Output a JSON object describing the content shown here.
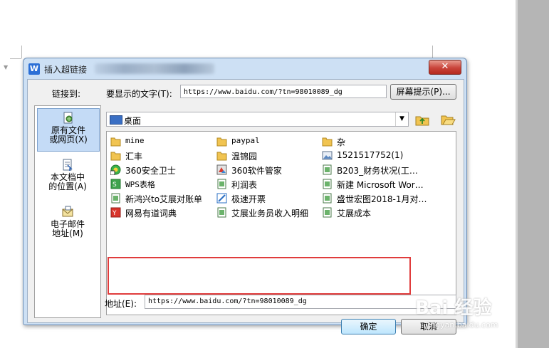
{
  "dialog": {
    "title": "插入超链接",
    "close_glyph": "✕",
    "link_to_label": "链接到:",
    "display_text_label": "要显示的文字(T):",
    "display_text_value": "https://www.baidu.com/?tn=98010089_dg",
    "screentip_button": "屏幕提示(P)...",
    "sidebar": [
      {
        "label_line1": "原有文件",
        "label_line2": "或网页(X)",
        "icon": "existing-file-icon",
        "active": true
      },
      {
        "label_line1": "本文档中",
        "label_line2": "的位置(A)",
        "icon": "place-in-document-icon",
        "active": false
      },
      {
        "label_line1": "电子邮件",
        "label_line2": "地址(M)",
        "icon": "email-address-icon",
        "active": false
      }
    ],
    "look_in_value": "桌面",
    "files": [
      {
        "name": "mine",
        "icon": "folder-icon"
      },
      {
        "name": "paypal",
        "icon": "folder-icon"
      },
      {
        "name": "杂",
        "icon": "folder-icon"
      },
      {
        "name": "汇丰",
        "icon": "folder-icon"
      },
      {
        "name": "温锦园",
        "icon": "folder-icon"
      },
      {
        "name": "1521517752(1)",
        "icon": "image-file-icon"
      },
      {
        "name": "360安全卫士",
        "icon": "shortcut-app-icon"
      },
      {
        "name": "360软件管家",
        "icon": "shortcut-app-icon"
      },
      {
        "name": "B203_财务状况(工…",
        "icon": "spreadsheet-icon"
      },
      {
        "name": "WPS表格",
        "icon": "shortcut-app-icon"
      },
      {
        "name": "利润表",
        "icon": "spreadsheet-icon"
      },
      {
        "name": "新建 Microsoft Wor…",
        "icon": "spreadsheet-icon"
      },
      {
        "name": "新鸿兴to艾展对账单",
        "icon": "spreadsheet-icon"
      },
      {
        "name": "极速开票",
        "icon": "shortcut-app-icon"
      },
      {
        "name": "盛世宏图2018-1月对…",
        "icon": "spreadsheet-icon"
      },
      {
        "name": "网易有道词典",
        "icon": "shortcut-app-icon"
      },
      {
        "name": "艾展业务员收入明细",
        "icon": "spreadsheet-icon"
      },
      {
        "name": "艾展成本",
        "icon": "spreadsheet-icon"
      }
    ],
    "address_label": "地址(E):",
    "address_value": "https://www.baidu.com/?tn=98010089_dg",
    "ok_button": "确定",
    "cancel_button": "取消"
  },
  "watermark": {
    "main": "Bai 经验",
    "sub": "jingyan.baidu.com"
  },
  "colors": {
    "highlight": "#e03c3c",
    "dialog_frame": "#cde0f4",
    "close_button": "#c9443a"
  }
}
